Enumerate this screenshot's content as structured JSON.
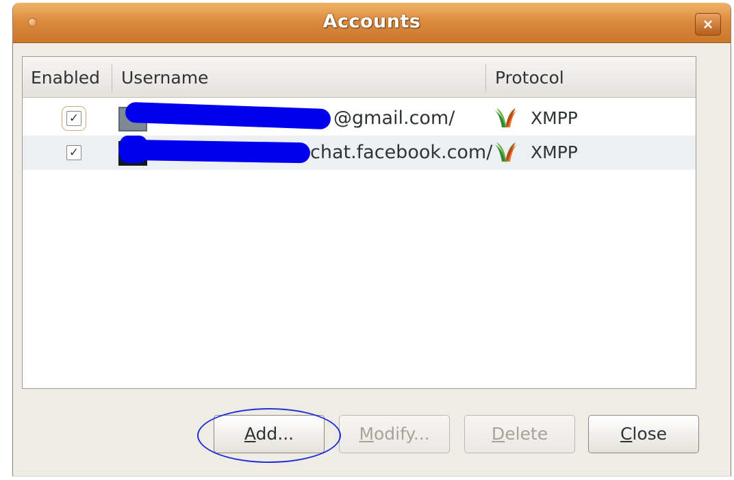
{
  "window": {
    "title": "Accounts",
    "close_glyph": "×"
  },
  "table": {
    "columns": [
      "Enabled",
      "Username",
      "Protocol"
    ],
    "rows": [
      {
        "enabled": true,
        "check_glyph": "✓",
        "username_visible": "@gmail.com/",
        "protocol": "XMPP",
        "protocol_icon": "xmpp-icon"
      },
      {
        "enabled": true,
        "check_glyph": "✓",
        "username_visible": "chat.facebook.com/",
        "protocol": "XMPP",
        "protocol_icon": "xmpp-icon"
      }
    ]
  },
  "buttons": {
    "add": {
      "mnemonic": "A",
      "rest": "dd...",
      "enabled": true
    },
    "modify": {
      "mnemonic": "M",
      "rest": "odify...",
      "enabled": false
    },
    "delete": {
      "mnemonic": "D",
      "rest": "elete",
      "enabled": false
    },
    "close": {
      "mnemonic": "C",
      "rest": "lose",
      "enabled": true
    }
  },
  "colors": {
    "titlebar": "#dc8b3f",
    "redaction": "#0000ee",
    "annotation_circle": "#1c2fd6"
  }
}
